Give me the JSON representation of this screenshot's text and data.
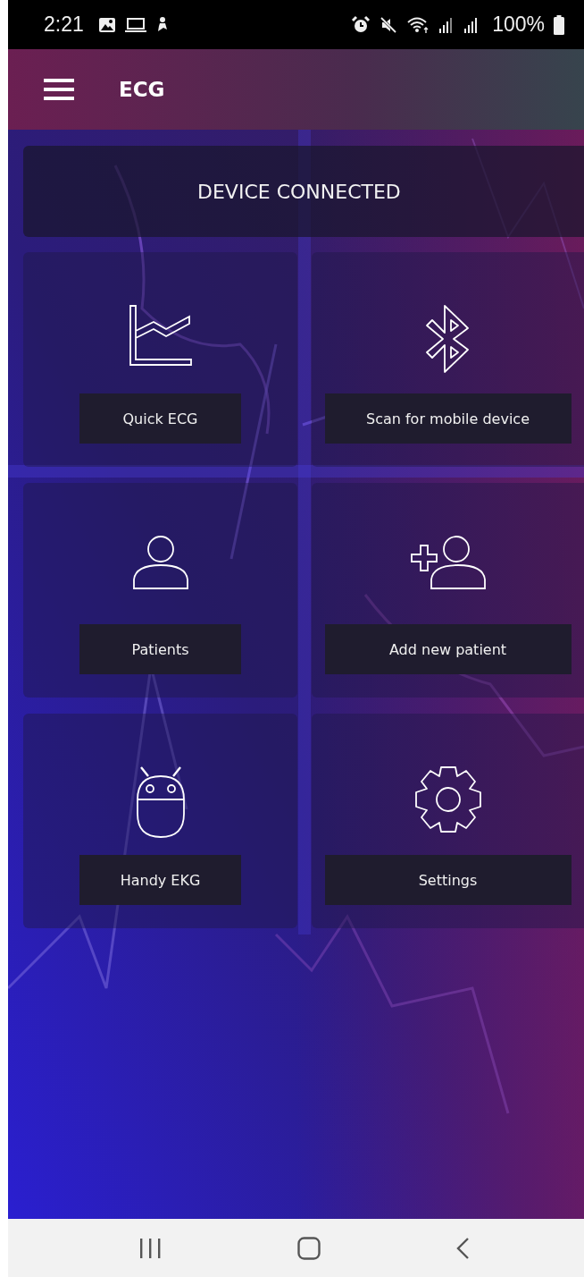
{
  "status_bar": {
    "time": "2:21",
    "battery": "100%"
  },
  "app_bar": {
    "title": "ECG"
  },
  "banner": {
    "text": "DEVICE CONNECTED"
  },
  "tiles": [
    {
      "kind": "chart",
      "label": "Quick ECG"
    },
    {
      "kind": "bluetooth",
      "label": "Scan for mobile device"
    },
    {
      "kind": "person",
      "label": "Patients"
    },
    {
      "kind": "add-person",
      "label": "Add new patient"
    },
    {
      "kind": "robot",
      "label": "Handy EKG"
    },
    {
      "kind": "gear",
      "label": "Settings"
    }
  ]
}
